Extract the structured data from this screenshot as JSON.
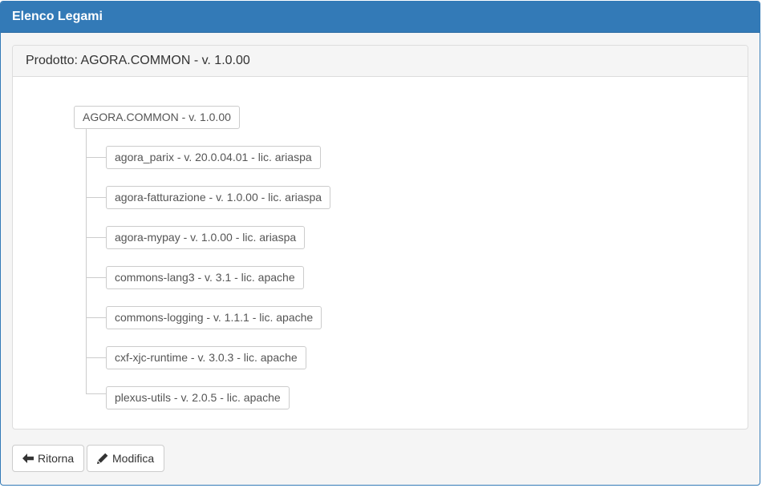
{
  "window": {
    "title": "Elenco Legami"
  },
  "panel": {
    "heading": "Prodotto: AGORA.COMMON - v. 1.0.00"
  },
  "tree": {
    "root": "AGORA.COMMON - v. 1.0.00",
    "children": [
      "agora_parix - v. 20.0.04.01 - lic. ariaspa",
      "agora-fatturazione - v. 1.0.00 - lic. ariaspa",
      "agora-mypay - v. 1.0.00 - lic. ariaspa",
      "commons-lang3 - v. 3.1 - lic. apache",
      "commons-logging - v. 1.1.1 - lic. apache",
      "cxf-xjc-runtime - v. 3.0.3 - lic. apache",
      "plexus-utils - v. 2.0.5 - lic. apache"
    ]
  },
  "buttons": {
    "back": {
      "label": "Ritorna",
      "icon": "arrow-left-icon"
    },
    "edit": {
      "label": "Modifica",
      "icon": "pencil-icon"
    }
  }
}
